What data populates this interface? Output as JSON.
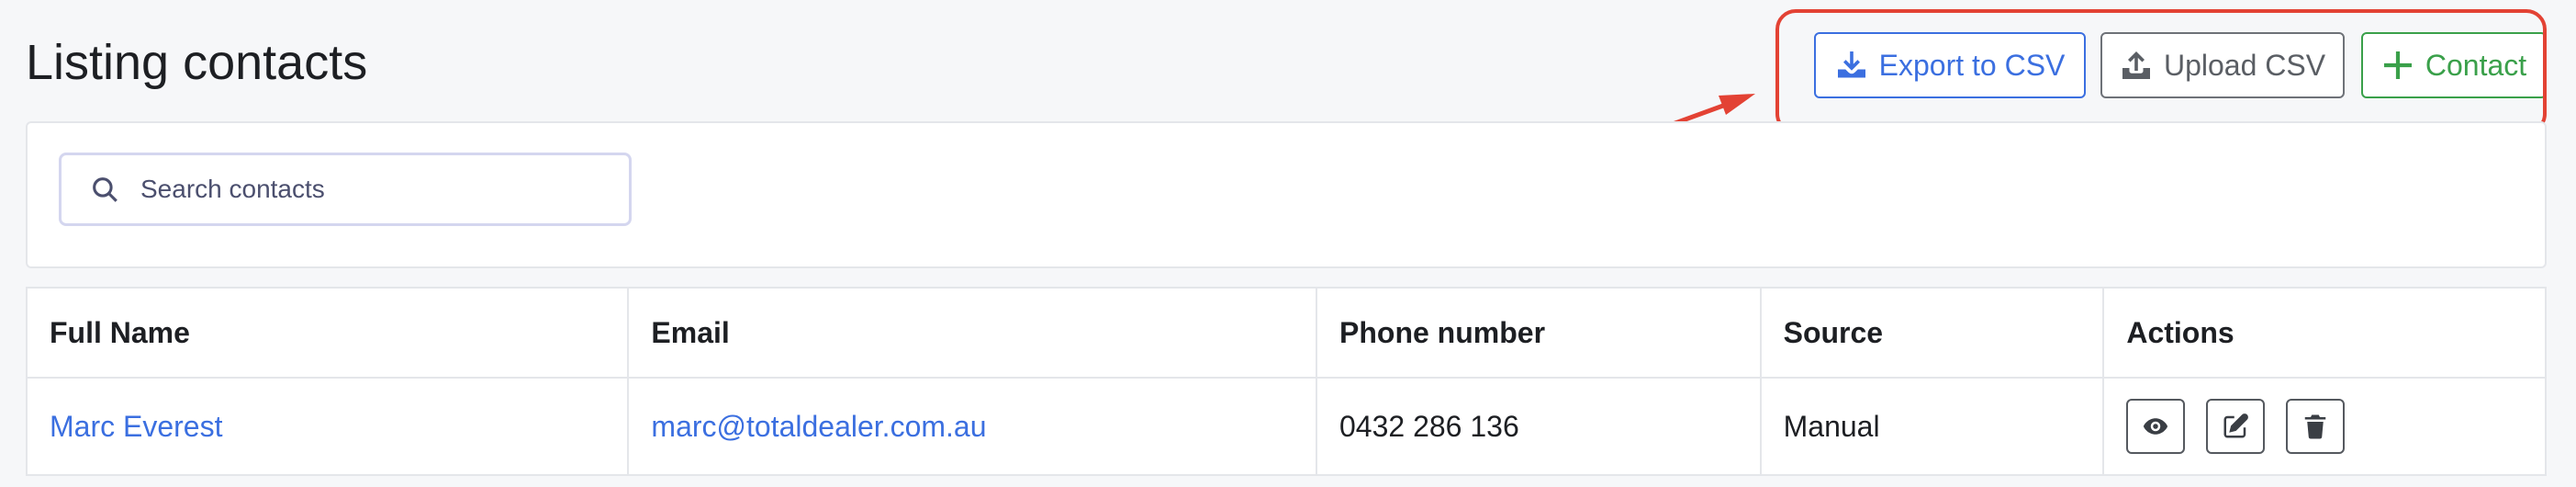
{
  "page": {
    "title": "Listing contacts"
  },
  "toolbar": {
    "export_label": "Export to CSV",
    "upload_label": "Upload CSV",
    "contact_label": "Contact"
  },
  "search": {
    "placeholder": "Search contacts",
    "value": ""
  },
  "table": {
    "columns": [
      "Full Name",
      "Email",
      "Phone number",
      "Source",
      "Actions"
    ],
    "rows": [
      {
        "full_name": "Marc Everest",
        "email": "marc@totaldealer.com.au",
        "phone": "0432 286 136",
        "source": "Manual"
      }
    ]
  },
  "icons": {
    "export": "download-icon",
    "upload": "upload-icon",
    "contact": "plus-icon",
    "search": "search-icon",
    "view": "eye-icon",
    "edit": "edit-icon",
    "delete": "trash-icon"
  },
  "colors": {
    "primary": "#3b6fe0",
    "secondary": "#6e7278",
    "success": "#3aa04a",
    "annotation": "#e34234"
  }
}
